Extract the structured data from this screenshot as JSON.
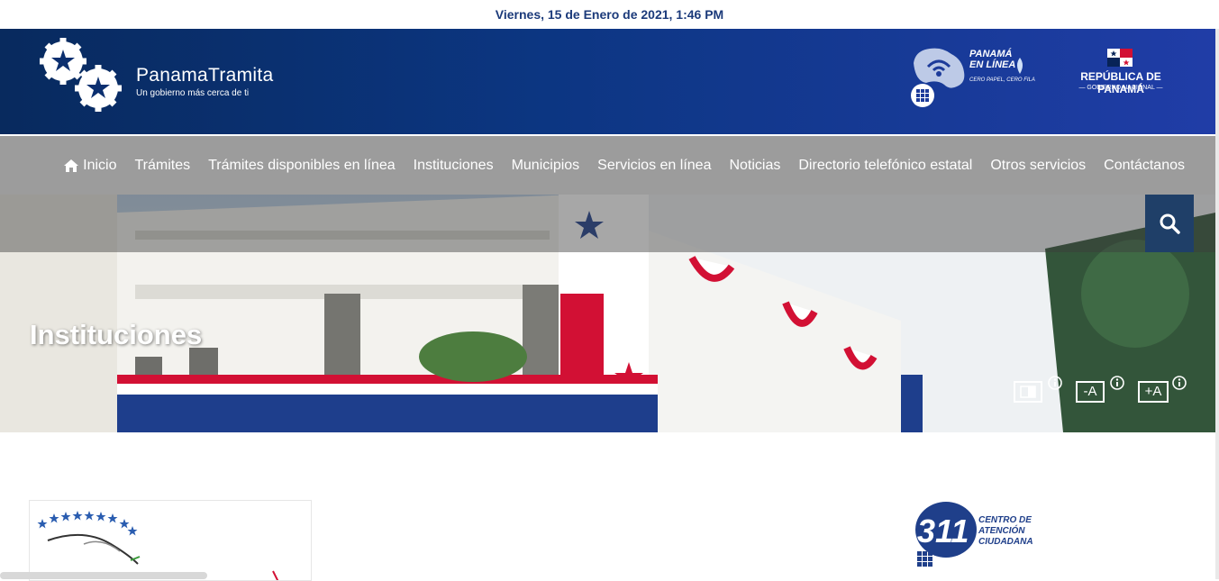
{
  "datetime": "Viernes, 15 de Enero de 2021, 1:46 PM",
  "brand": {
    "title": "PanamaTramita",
    "subtitle": "Un gobierno más cerca de ti"
  },
  "partners": {
    "panama_en_linea": {
      "line1": "PANAMÁ",
      "line2": "EN LÍNEA",
      "tagline": "CERO PAPEL, CERO FILA"
    },
    "republica": {
      "title": "REPÚBLICA DE PANAMÁ",
      "subtitle": "— GOBIERNO NACIONAL —"
    }
  },
  "nav": {
    "items": [
      {
        "label": "Inicio",
        "icon": "home-icon"
      },
      {
        "label": "Trámites"
      },
      {
        "label": "Trámites disponibles en línea"
      },
      {
        "label": "Instituciones"
      },
      {
        "label": "Municipios"
      },
      {
        "label": "Servicios en línea"
      },
      {
        "label": "Noticias"
      },
      {
        "label": "Directorio telefónico estatal"
      },
      {
        "label": "Otros servicios"
      },
      {
        "label": "Contáctanos"
      }
    ]
  },
  "hero": {
    "title": "Instituciones",
    "search_icon": "search-icon"
  },
  "accessibility": {
    "contrast_icon": "contrast-icon",
    "decrease_label": "-A",
    "increase_label": "+A",
    "info_icon": "info-icon"
  },
  "center311": {
    "number": "311",
    "line1": "CENTRO DE",
    "line2": "ATENCIÓN",
    "line3": "CIUDADANA"
  },
  "colors": {
    "brand_blue": "#0c3682",
    "nav_gray": "#9c9c9c",
    "search_bg": "#1f3f68",
    "date_text": "#1b3a7a"
  }
}
